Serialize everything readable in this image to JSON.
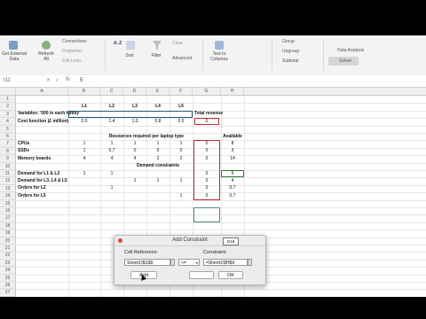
{
  "ribbon": {
    "get_external_data": "Get External Data",
    "refresh_all": "Refresh All",
    "connections": "Connections",
    "properties": "Properties",
    "edit_links": "Edit Links",
    "sort_az": "A↓Z",
    "sort": "Sort",
    "filter": "Filter",
    "clear": "Clear",
    "advanced": "Advanced",
    "text_to_columns": "Text to Columns",
    "group": "Group",
    "ungroup": "Ungroup",
    "subtotal": "Subtotal",
    "data_analysis": "Data Analysis",
    "solver": "Solver"
  },
  "formula_bar": {
    "name_box": "I11",
    "formula_value": "5"
  },
  "columns": [
    "A",
    "B",
    "C",
    "D",
    "E",
    "F",
    "G",
    "H"
  ],
  "rows": [
    "1",
    "2",
    "3",
    "4",
    "5",
    "6",
    "7",
    "8",
    "9",
    "10",
    "11",
    "12",
    "13",
    "14",
    "15",
    "16",
    "17",
    "18",
    "19",
    "20",
    "21",
    "22",
    "23",
    "24",
    "25",
    "26",
    "27"
  ],
  "sheet": {
    "l_headers": [
      "L1",
      "L2",
      "L3",
      "L4",
      "L5"
    ],
    "variables_label": "Variables: '000 in each family",
    "total_revenue_label": "Total revenue",
    "cost_label": "Cost function (£ million)",
    "cost_values": [
      "2.0",
      "1.4",
      "1.0",
      "0.8",
      "0.5"
    ],
    "total_revenue_value": "0",
    "resources_title": "Resources required per laptop type",
    "available_label": "Available",
    "resource_rows": [
      {
        "label": "CPUs",
        "values": [
          "1",
          "1",
          "1",
          "1",
          "1"
        ],
        "g": "0",
        "h": "8"
      },
      {
        "label": "SSDs",
        "values": [
          "1",
          "0.7",
          "0",
          "0",
          "0"
        ],
        "g": "0",
        "h": "3"
      },
      {
        "label": "Memory boards",
        "values": [
          "4",
          "4",
          "4",
          "2",
          "2"
        ],
        "g": "0",
        "h": "14"
      }
    ],
    "demand_title": "Demand constraints",
    "demand_rows": [
      {
        "label": "Demand for L1 & L2",
        "values": [
          "1",
          "1",
          "",
          "",
          ""
        ],
        "g": "0",
        "h": "5"
      },
      {
        "label": "Demand for L3, L4 & L5",
        "values": [
          "",
          "",
          "1",
          "1",
          "1"
        ],
        "g": "0",
        "h": "4"
      },
      {
        "label": "Orders for L2",
        "values": [
          "",
          "1",
          "",
          "",
          ""
        ],
        "g": "0",
        "h": "0.7"
      },
      {
        "label": "Orders for L5",
        "values": [
          "",
          "",
          "",
          "",
          "1"
        ],
        "g": "0",
        "h": "0.7"
      }
    ]
  },
  "dialog": {
    "title": "Add Constraint",
    "ref_tag": "G16",
    "cell_reference_label": "Cell Reference:",
    "constraint_label": "Constraint:",
    "cell_reference_value": "Sheet1!$G$9",
    "operator_value": "<=",
    "constraint_value": "=Sheet1!$H$9",
    "add_button": "Add",
    "ok_button": "OK"
  },
  "colors": {
    "selected_border": "#2e7d32",
    "total_border": "#c62828",
    "dialog_close": "#e0443e"
  }
}
